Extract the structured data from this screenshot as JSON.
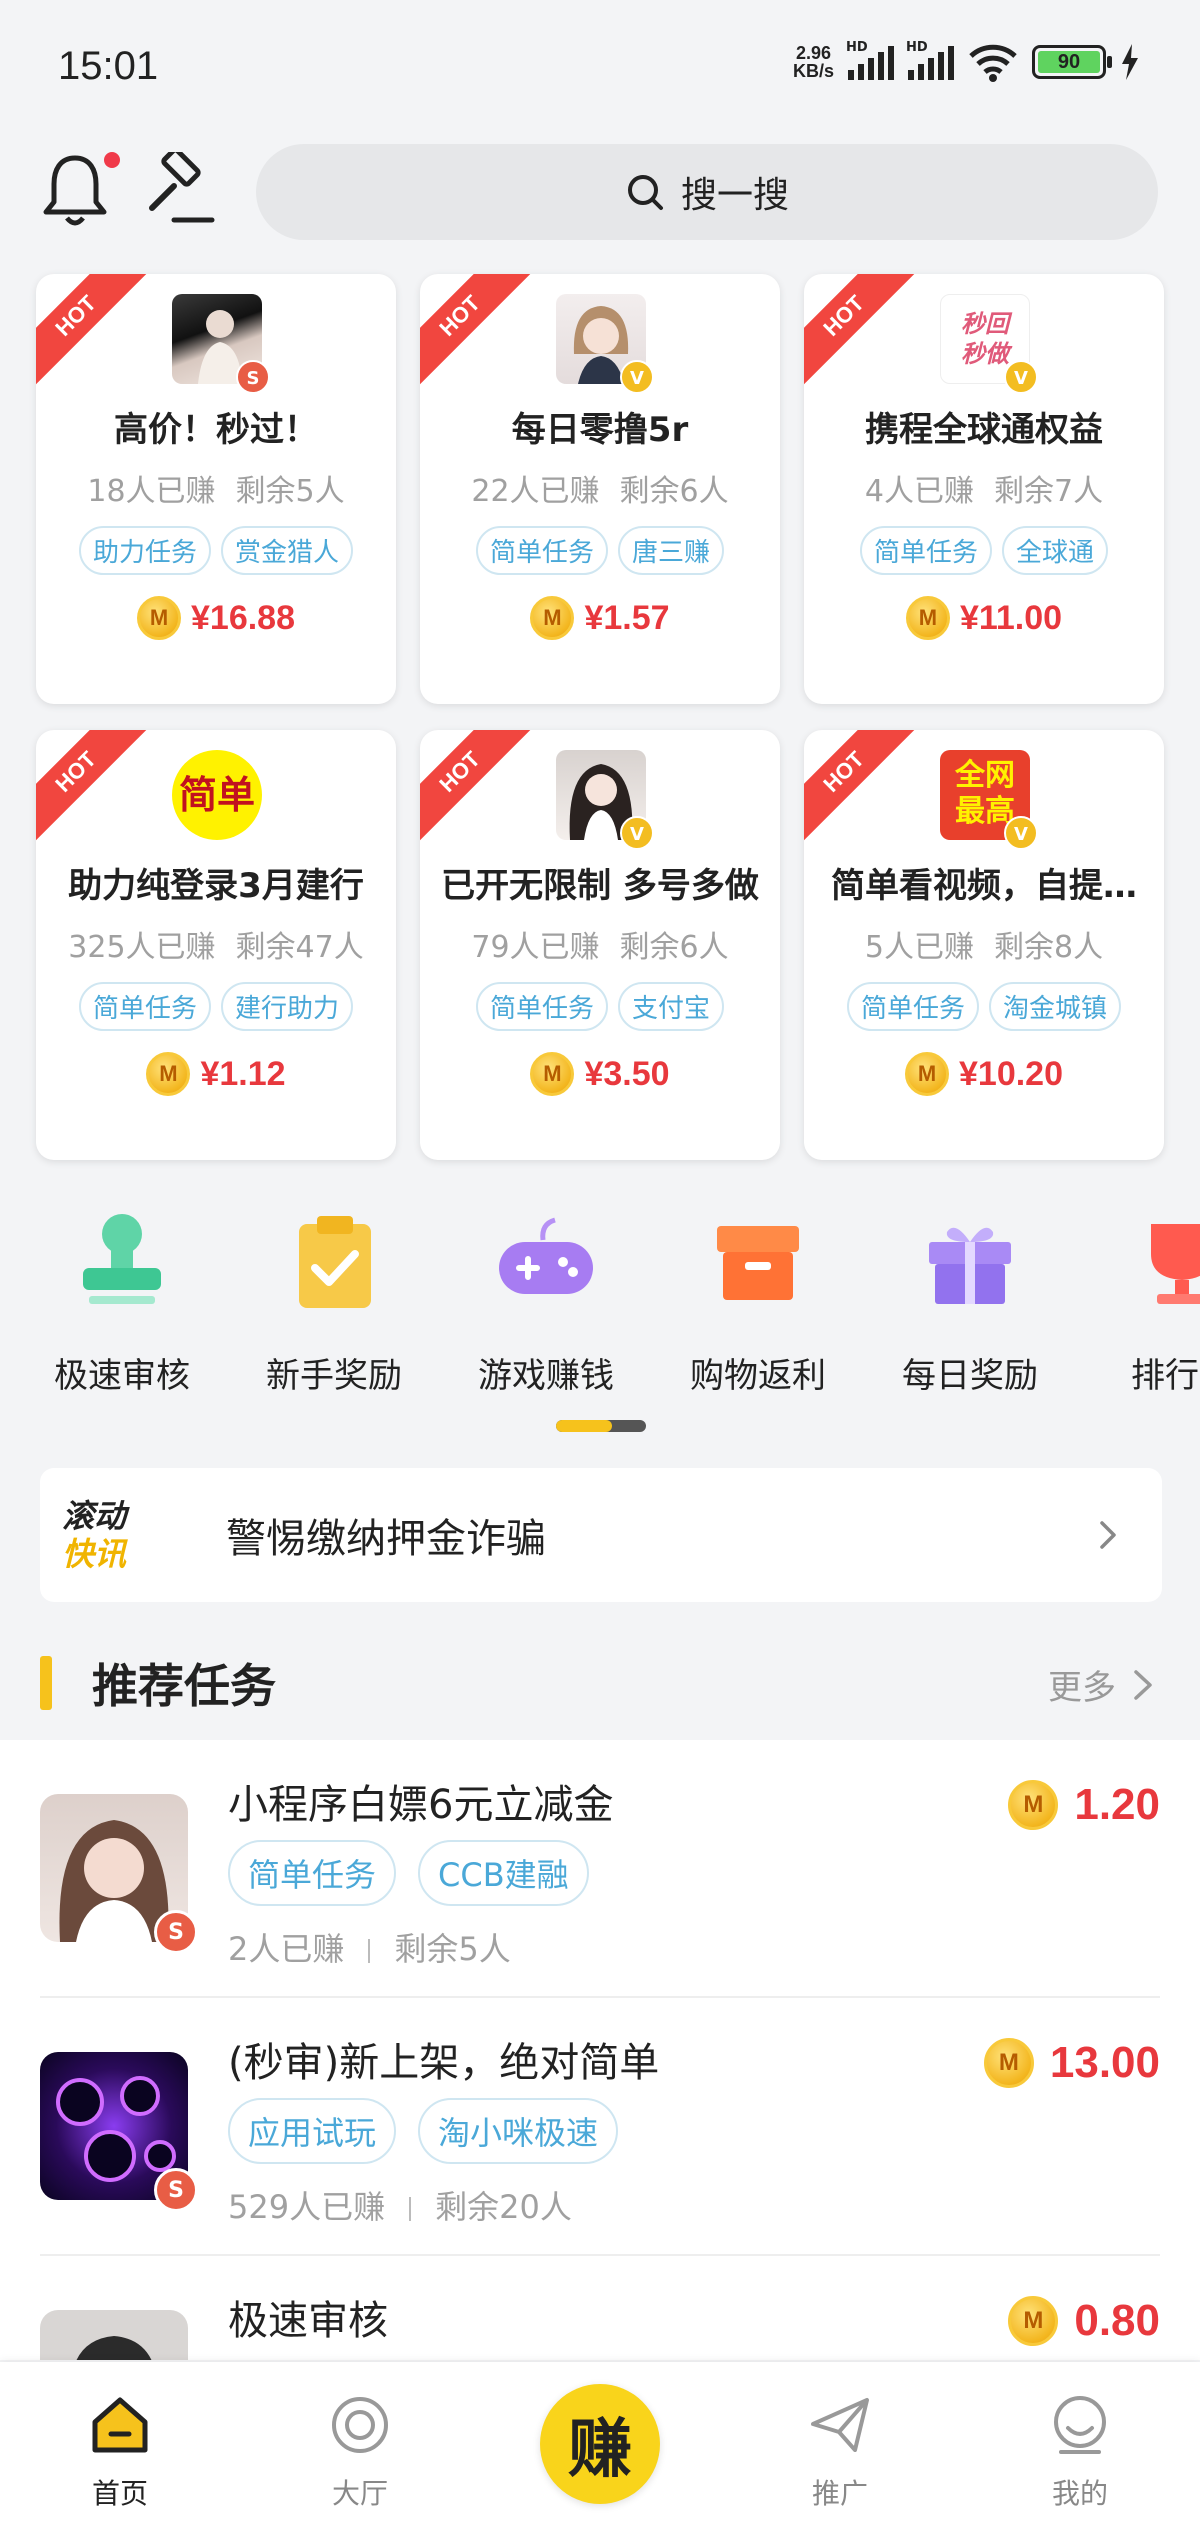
{
  "status_bar": {
    "time": "15:01",
    "net_speed_value": "2.96",
    "net_speed_unit": "KB/s",
    "battery": "90"
  },
  "header": {
    "search_placeholder": "搜一搜"
  },
  "hot_cards": [
    {
      "ribbon": "HOT",
      "title": "高价！秒过！",
      "earned": "18人已赚",
      "remaining": "剩余5人",
      "tags": [
        "助力任务",
        "赏金猎人"
      ],
      "price": "¥16.88",
      "badge": "S"
    },
    {
      "ribbon": "HOT",
      "title": "每日零撸5r",
      "earned": "22人已赚",
      "remaining": "剩余6人",
      "tags": [
        "简单任务",
        "唐三赚"
      ],
      "price": "¥1.57",
      "badge": "V"
    },
    {
      "ribbon": "HOT",
      "title": "携程全球通权益",
      "earned": "4人已赚",
      "remaining": "剩余7人",
      "tags": [
        "简单任务",
        "全球通"
      ],
      "price": "¥11.00",
      "badge": "V",
      "avatar_text": "秒回秒做"
    },
    {
      "ribbon": "HOT",
      "title": "助力纯登录3月建行",
      "earned": "325人已赚",
      "remaining": "剩余47人",
      "tags": [
        "简单任务",
        "建行助力"
      ],
      "price": "¥1.12",
      "badge": "",
      "avatar_text": "简单"
    },
    {
      "ribbon": "HOT",
      "title": "已开无限制 多号多做",
      "earned": "79人已赚",
      "remaining": "剩余6人",
      "tags": [
        "简单任务",
        "支付宝"
      ],
      "price": "¥3.50",
      "badge": "V"
    },
    {
      "ribbon": "HOT",
      "title": "简单看视频，自提…",
      "earned": "5人已赚",
      "remaining": "剩余8人",
      "tags": [
        "简单任务",
        "淘金城镇"
      ],
      "price": "¥10.20",
      "badge": "V",
      "avatar_text": "全网最高"
    }
  ],
  "categories": [
    {
      "label": "极速审核",
      "icon": "stamp-icon"
    },
    {
      "label": "新手奖励",
      "icon": "clipboard-check-icon"
    },
    {
      "label": "游戏赚钱",
      "icon": "gamepad-icon"
    },
    {
      "label": "购物返利",
      "icon": "box-icon"
    },
    {
      "label": "每日奖励",
      "icon": "gift-icon"
    },
    {
      "label": "排行…",
      "icon": "trophy-icon"
    }
  ],
  "notice": {
    "logo_line1": "滚动",
    "logo_line2": "快讯",
    "text": "警惕缴纳押金诈骗"
  },
  "section": {
    "title": "推荐任务",
    "more": "更多"
  },
  "tasks": [
    {
      "title": "小程序白嫖6元立减金",
      "tags": [
        "简单任务",
        "CCB建融"
      ],
      "earned": "2人已赚",
      "remaining": "剩余5人",
      "price": "1.20",
      "badge": "S"
    },
    {
      "title": "(秒审)新上架，绝对简单",
      "tags": [
        "应用试玩",
        "淘小咪极速"
      ],
      "earned": "529人已赚",
      "remaining": "剩余20人",
      "price": "13.00",
      "badge": "S"
    },
    {
      "title": "极速审核",
      "tags": [
        "",
        ""
      ],
      "earned": "",
      "remaining": "",
      "price": "0.80",
      "badge": ""
    }
  ],
  "bottom_nav": {
    "home": "首页",
    "hall": "大厅",
    "earn": "赚",
    "promote": "推广",
    "mine": "我的"
  },
  "colors": {
    "accent_yellow": "#f6c21c",
    "price_red": "#e8383d",
    "tag_blue": "#4aa8d8",
    "hot_red": "#f1463f"
  }
}
